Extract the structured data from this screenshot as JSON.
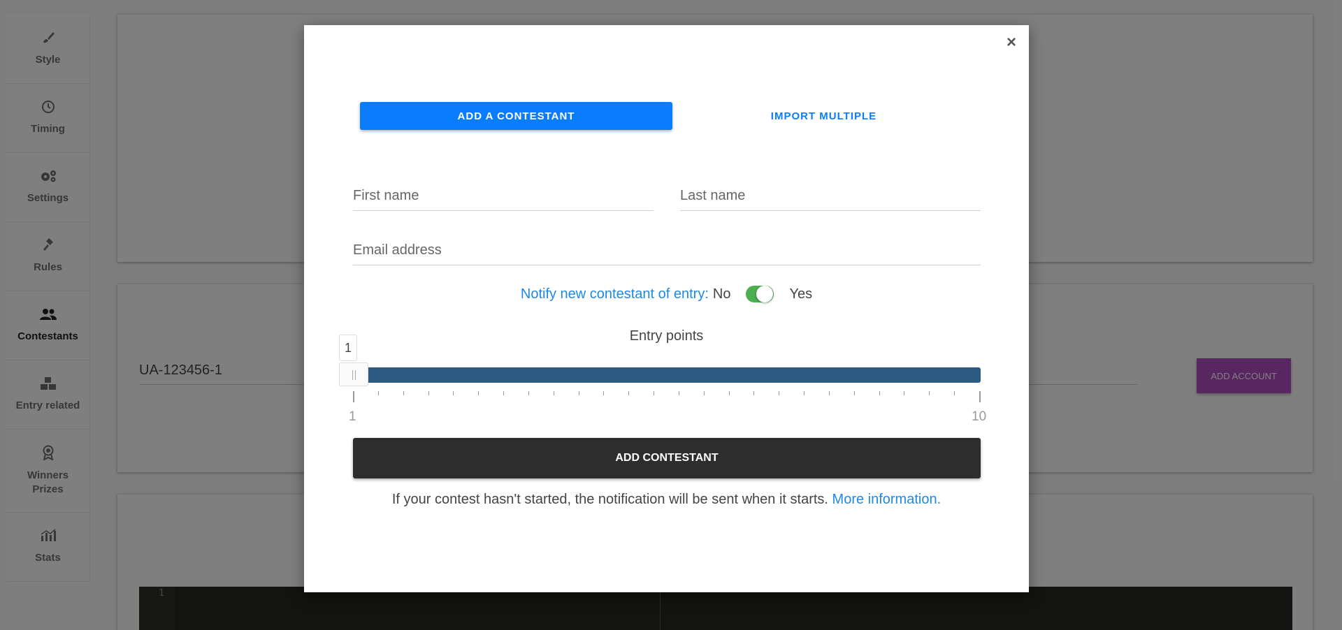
{
  "sidebar": {
    "items": [
      {
        "label": "Style",
        "icon": "brush-icon"
      },
      {
        "label": "Timing",
        "icon": "clock-icon"
      },
      {
        "label": "Settings",
        "icon": "gears-icon"
      },
      {
        "label": "Rules",
        "icon": "gavel-icon"
      },
      {
        "label": "Contestants",
        "icon": "users-icon",
        "active": true
      },
      {
        "label": "Entry related",
        "icon": "boxes-icon"
      },
      {
        "label": "Winners Prizes",
        "line1": "Winners",
        "line2": "Prizes",
        "icon": "award-icon"
      },
      {
        "label": "Stats",
        "icon": "bar-chart-icon"
      }
    ]
  },
  "background": {
    "account_input_value": "UA-123456-1",
    "add_account_label": "ADD ACCOUNT",
    "code_line_number": "1",
    "add_account_color": "#b14fc5"
  },
  "modal": {
    "close_label": "×",
    "tabs": {
      "add_label": "ADD A CONTESTANT",
      "import_label": "IMPORT MULTIPLE"
    },
    "fields": {
      "first_name_placeholder": "First name",
      "last_name_placeholder": "Last name",
      "email_placeholder": "Email address",
      "first_name_value": "",
      "last_name_value": "",
      "email_value": ""
    },
    "notify": {
      "label": "Notify new contestant of entry:",
      "no_label": "No",
      "yes_label": "Yes",
      "enabled": true,
      "toggle_color": "#4caf50"
    },
    "entry_points": {
      "label": "Entry points",
      "value": "1",
      "min": "1",
      "max": "10",
      "track_color": "#2c5a82"
    },
    "submit_label": "ADD CONTESTANT",
    "footnote": {
      "text": "If your contest hasn't started, the notification will be sent when it starts. ",
      "link": "More information."
    },
    "accent_color": "#0a7dff"
  }
}
